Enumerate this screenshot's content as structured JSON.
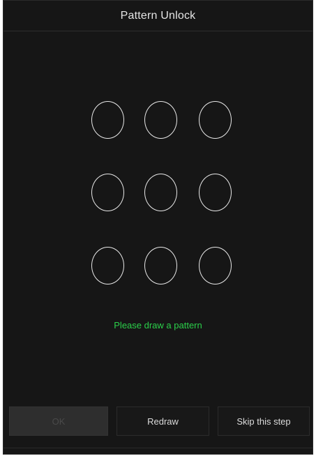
{
  "header": {
    "title": "Pattern Unlock"
  },
  "pattern": {
    "hint": "Please draw a pattern",
    "hint_color": "#2bd04a",
    "dots": [
      1,
      2,
      3,
      4,
      5,
      6,
      7,
      8,
      9
    ]
  },
  "buttons": {
    "confirm_label": "OK",
    "redraw_label": "Redraw",
    "skip_label": "Skip this step"
  }
}
